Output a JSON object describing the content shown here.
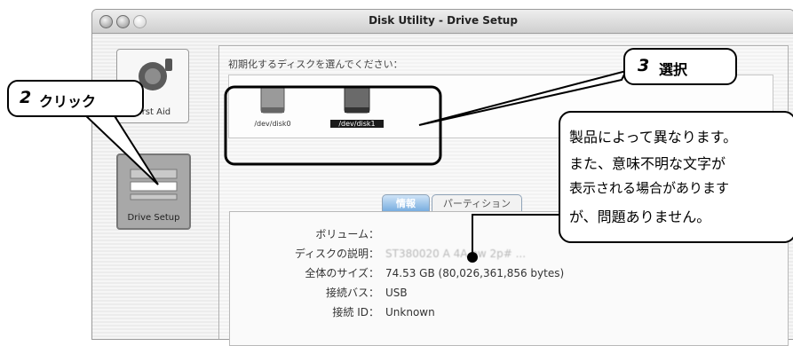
{
  "window": {
    "title": "Disk Utility - Drive Setup",
    "background": "#f4f4f4"
  },
  "sidebar": {
    "tools": [
      {
        "label": "First Aid",
        "icon": "first-aid-icon"
      },
      {
        "label": "Drive Setup",
        "icon": "drive-setup-icon"
      }
    ]
  },
  "main": {
    "prompt": "初期化するディスクを選んでください：",
    "disks": [
      {
        "label": "/dev/disk0",
        "selected": false
      },
      {
        "label": "/dev/disk1",
        "selected": true
      }
    ],
    "tabs": [
      {
        "label": "情報",
        "active": true
      },
      {
        "label": "パーティション",
        "active": false
      }
    ],
    "info": [
      {
        "key": "ボリューム：",
        "value": ""
      },
      {
        "key": "ディスクの説明：",
        "value": "ST380020 A            4A bw 2p# ..."
      },
      {
        "key": "全体のサイズ：",
        "value": "74.53 GB (80,026,361,856 bytes)"
      },
      {
        "key": "接続バス：",
        "value": "USB"
      },
      {
        "key": "接続 ID：",
        "value": "Unknown"
      }
    ]
  },
  "annotations": {
    "step2": {
      "num": "2",
      "text": "クリック"
    },
    "step3": {
      "num": "3",
      "text": "選択"
    },
    "note": [
      "製品によって異なります。",
      "また、意味不明な文字が",
      "表示される場合がありますが、問題ありません。"
    ]
  },
  "colors": {
    "accent": "#6fa7dd",
    "selected": "#1a1a1a"
  }
}
